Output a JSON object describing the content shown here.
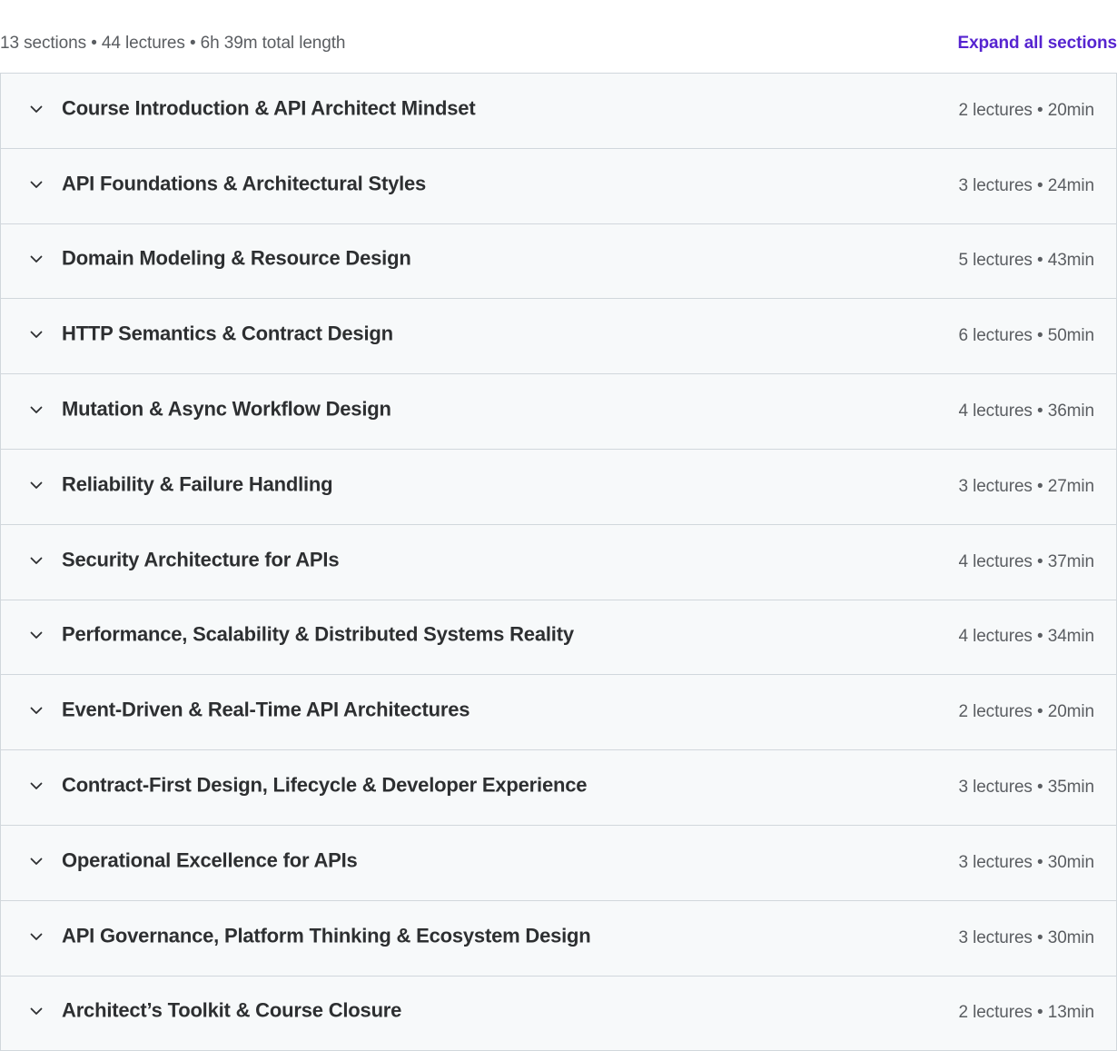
{
  "summary": {
    "text": "13 sections • 44 lectures • 6h 39m total length",
    "expand_all_label": "Expand all sections"
  },
  "colors": {
    "accent": "#5624d0",
    "row_background": "#f7f9fa",
    "border": "#d1d7dc",
    "title_text": "#2d2f31",
    "meta_text": "#5a5d61"
  },
  "sections": [
    {
      "title": "Course Introduction & API Architect Mindset",
      "meta": "2 lectures • 20min",
      "icon": "chevron-down-icon"
    },
    {
      "title": "API Foundations & Architectural Styles",
      "meta": "3 lectures • 24min",
      "icon": "chevron-down-icon"
    },
    {
      "title": "Domain Modeling & Resource Design",
      "meta": "5 lectures • 43min",
      "icon": "chevron-down-icon"
    },
    {
      "title": "HTTP Semantics & Contract Design",
      "meta": "6 lectures • 50min",
      "icon": "chevron-down-icon"
    },
    {
      "title": "Mutation & Async Workflow Design",
      "meta": "4 lectures • 36min",
      "icon": "chevron-down-icon"
    },
    {
      "title": "Reliability & Failure Handling",
      "meta": "3 lectures • 27min",
      "icon": "chevron-down-icon"
    },
    {
      "title": "Security Architecture for APIs",
      "meta": "4 lectures • 37min",
      "icon": "chevron-down-icon"
    },
    {
      "title": "Performance, Scalability & Distributed Systems Reality",
      "meta": "4 lectures • 34min",
      "icon": "chevron-down-icon"
    },
    {
      "title": "Event-Driven & Real-Time API Architectures",
      "meta": "2 lectures • 20min",
      "icon": "chevron-down-icon"
    },
    {
      "title": "Contract-First Design, Lifecycle & Developer Experience",
      "meta": "3 lectures • 35min",
      "icon": "chevron-down-icon"
    },
    {
      "title": "Operational Excellence for APIs",
      "meta": "3 lectures • 30min",
      "icon": "chevron-down-icon"
    },
    {
      "title": "API Governance, Platform Thinking & Ecosystem Design",
      "meta": "3 lectures • 30min",
      "icon": "chevron-down-icon"
    },
    {
      "title": "Architect’s Toolkit & Course Closure",
      "meta": "2 lectures • 13min",
      "icon": "chevron-down-icon"
    }
  ]
}
